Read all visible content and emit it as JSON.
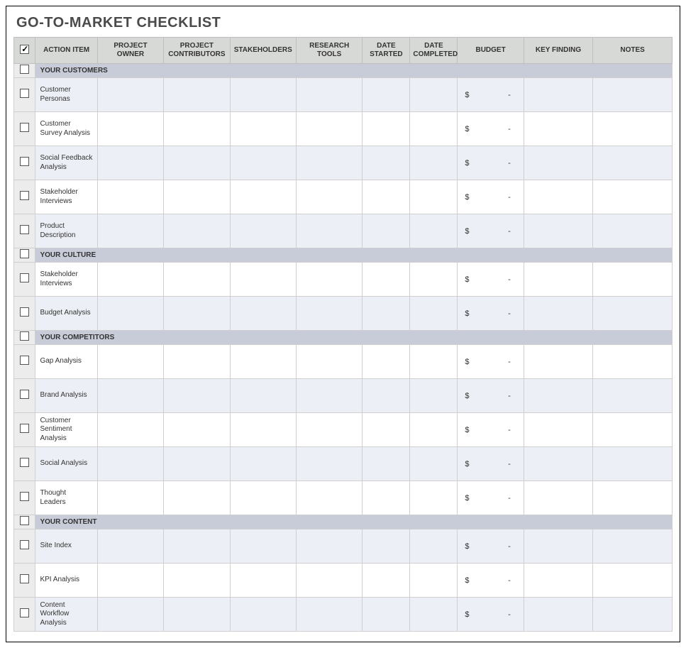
{
  "title": "GO-TO-MARKET CHECKLIST",
  "headers": {
    "action_item": "ACTION ITEM",
    "project_owner": "PROJECT OWNER",
    "project_contributors": "PROJECT CONTRIBUTORS",
    "stakeholders": "STAKEHOLDERS",
    "research_tools": "RESEARCH TOOLS",
    "date_started": "DATE STARTED",
    "date_completed": "DATE COMPLETED",
    "budget": "BUDGET",
    "key_finding": "KEY FINDING",
    "notes": "NOTES"
  },
  "budget_currency": "$",
  "budget_empty": "-",
  "sections": [
    {
      "label": "YOUR CUSTOMERS",
      "rows": [
        {
          "action": "Customer Personas",
          "budget": ""
        },
        {
          "action": "Customer Survey Analysis",
          "budget": ""
        },
        {
          "action": "Social Feedback Analysis",
          "budget": ""
        },
        {
          "action": "Stakeholder Interviews",
          "budget": ""
        },
        {
          "action": "Product Description",
          "budget": ""
        }
      ]
    },
    {
      "label": "YOUR CULTURE",
      "rows": [
        {
          "action": "Stakeholder Interviews",
          "budget": ""
        },
        {
          "action": "Budget Analysis",
          "budget": ""
        }
      ]
    },
    {
      "label": "YOUR COMPETITORS",
      "rows": [
        {
          "action": "Gap Analysis",
          "budget": ""
        },
        {
          "action": "Brand Analysis",
          "budget": ""
        },
        {
          "action": "Customer Sentiment Analysis",
          "budget": ""
        },
        {
          "action": "Social Analysis",
          "budget": ""
        },
        {
          "action": "Thought Leaders",
          "budget": ""
        }
      ]
    },
    {
      "label": "YOUR CONTENT",
      "rows": [
        {
          "action": "Site Index",
          "budget": ""
        },
        {
          "action": "KPI Analysis",
          "budget": ""
        },
        {
          "action": "Content Workflow Analysis",
          "budget": ""
        }
      ]
    }
  ]
}
